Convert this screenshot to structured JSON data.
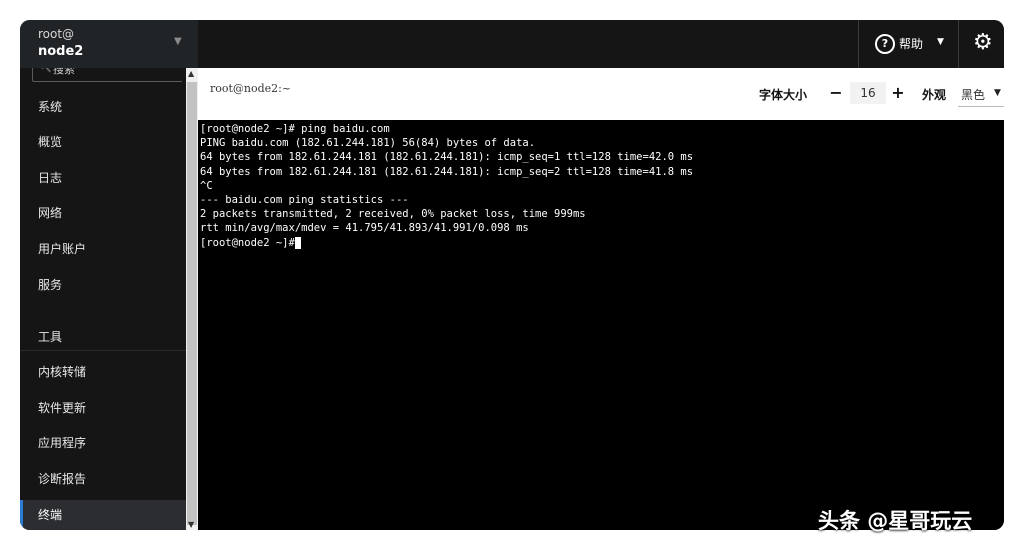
{
  "sidebar": {
    "host_user": "root@",
    "host_name": "node2",
    "search_placeholder": "搜索",
    "items": [
      {
        "label": "系统"
      },
      {
        "label": "概览"
      },
      {
        "label": "日志"
      },
      {
        "label": "网络"
      },
      {
        "label": "用户账户"
      },
      {
        "label": "服务"
      },
      {
        "label": "工具"
      },
      {
        "label": "内核转储"
      },
      {
        "label": "软件更新"
      },
      {
        "label": "应用程序"
      },
      {
        "label": "诊断报告"
      },
      {
        "label": "终端",
        "active": true
      }
    ]
  },
  "topbar": {
    "help_label": "帮助"
  },
  "terminal": {
    "title": "root@node2:~",
    "font_size_label": "字体大小",
    "font_size_value": "16",
    "decrease_label": "−",
    "increase_label": "+",
    "appearance_label": "外观",
    "theme_value": "黑色",
    "lines": [
      "[root@node2 ~]# ping baidu.com",
      "PING baidu.com (182.61.244.181) 56(84) bytes of data.",
      "64 bytes from 182.61.244.181 (182.61.244.181): icmp_seq=1 ttl=128 time=42.0 ms",
      "64 bytes from 182.61.244.181 (182.61.244.181): icmp_seq=2 ttl=128 time=41.8 ms",
      "^C",
      "--- baidu.com ping statistics ---",
      "2 packets transmitted, 2 received, 0% packet loss, time 999ms",
      "rtt min/avg/max/mdev = 41.795/41.893/41.991/0.098 ms",
      "[root@node2 ~]#"
    ]
  },
  "watermark": "头条 @星哥玩云"
}
